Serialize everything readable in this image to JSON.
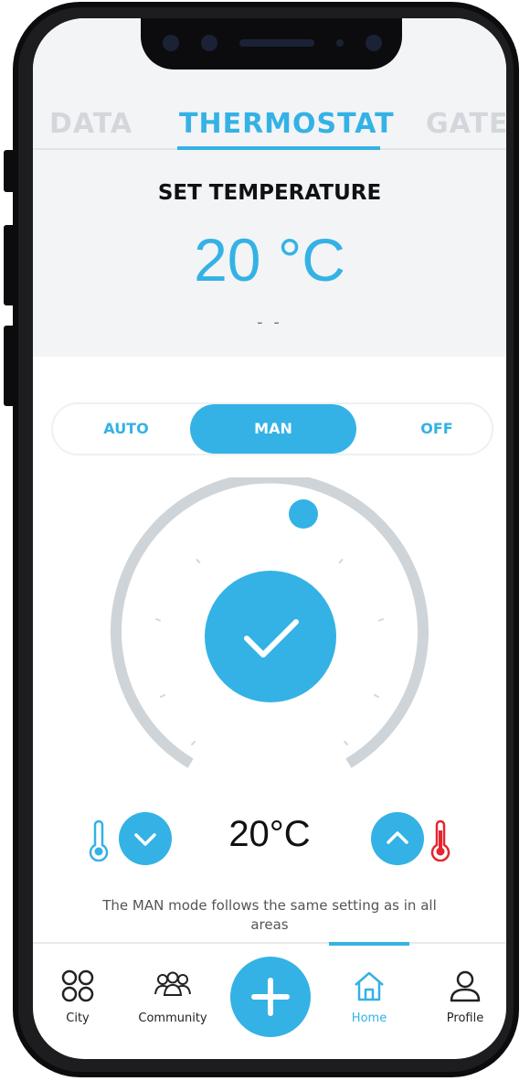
{
  "tabs": [
    "DATA",
    "THERMOSTAT",
    "GATE"
  ],
  "active_tab": "THERMOSTAT",
  "set_temperature": {
    "title": "SET TEMPERATURE",
    "value": "20 °C",
    "secondary": "- -"
  },
  "modes": {
    "auto": "AUTO",
    "man": "MAN",
    "off": "OFF",
    "selected": "MAN"
  },
  "dial": {
    "confirm_icon": "check-icon"
  },
  "controls": {
    "current_temp": "20°C",
    "decrease_icon": "chevron-down-icon",
    "increase_icon": "chevron-up-icon",
    "cold_icon": "thermometer-cold-icon",
    "hot_icon": "thermometer-hot-icon"
  },
  "mode_note": "The MAN mode follows the same setting as in all areas",
  "nav": {
    "city": "City",
    "community": "Community",
    "home": "Home",
    "profile": "Profile",
    "active": "Home"
  },
  "colors": {
    "accent": "#34b2e5",
    "cold": "#34b2e5",
    "hot": "#e3262f"
  }
}
